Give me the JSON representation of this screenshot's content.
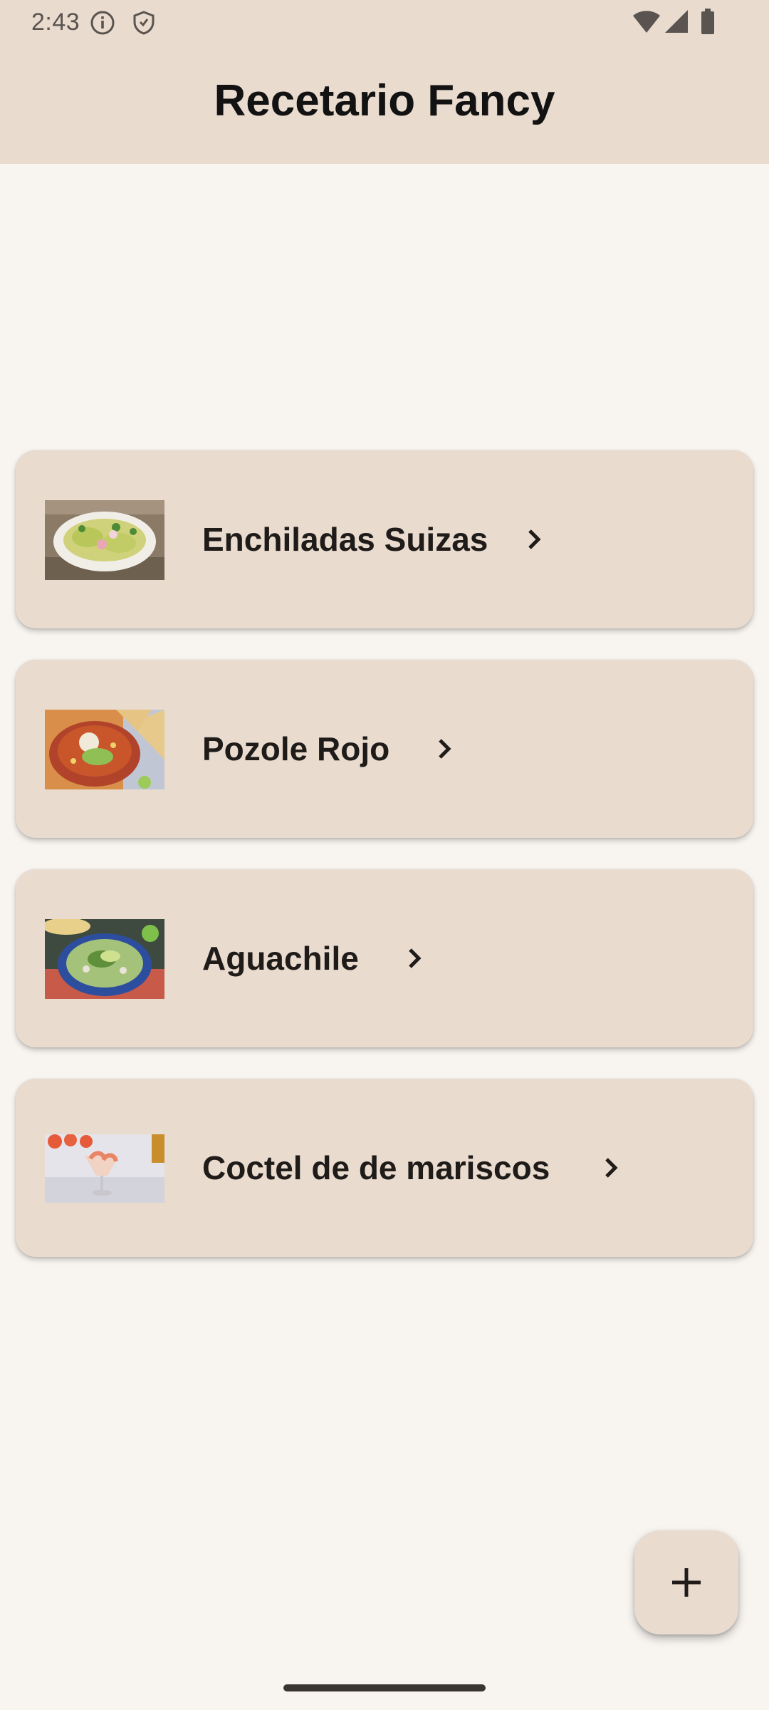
{
  "status_bar": {
    "time": "2:43",
    "icons_left": [
      "info-icon",
      "shield-icon"
    ],
    "icons_right": [
      "wifi-icon",
      "signal-icon",
      "battery-icon"
    ]
  },
  "app_bar": {
    "title": "Recetario Fancy"
  },
  "recipes": [
    {
      "title": "Enchiladas Suizas",
      "image": "enchiladas-image",
      "action_icon": "chevron-right-icon"
    },
    {
      "title": "Pozole Rojo",
      "image": "pozole-image",
      "action_icon": "chevron-right-icon"
    },
    {
      "title": "Aguachile",
      "image": "aguachile-image",
      "action_icon": "chevron-right-icon"
    },
    {
      "title": "Coctel de de mariscos",
      "image": "coctel-image",
      "action_icon": "chevron-right-icon"
    }
  ],
  "fab": {
    "icon": "plus-icon"
  },
  "colors": {
    "background": "#f8f4f0",
    "surface": "#eadbcf",
    "text": "#1e1b19"
  }
}
